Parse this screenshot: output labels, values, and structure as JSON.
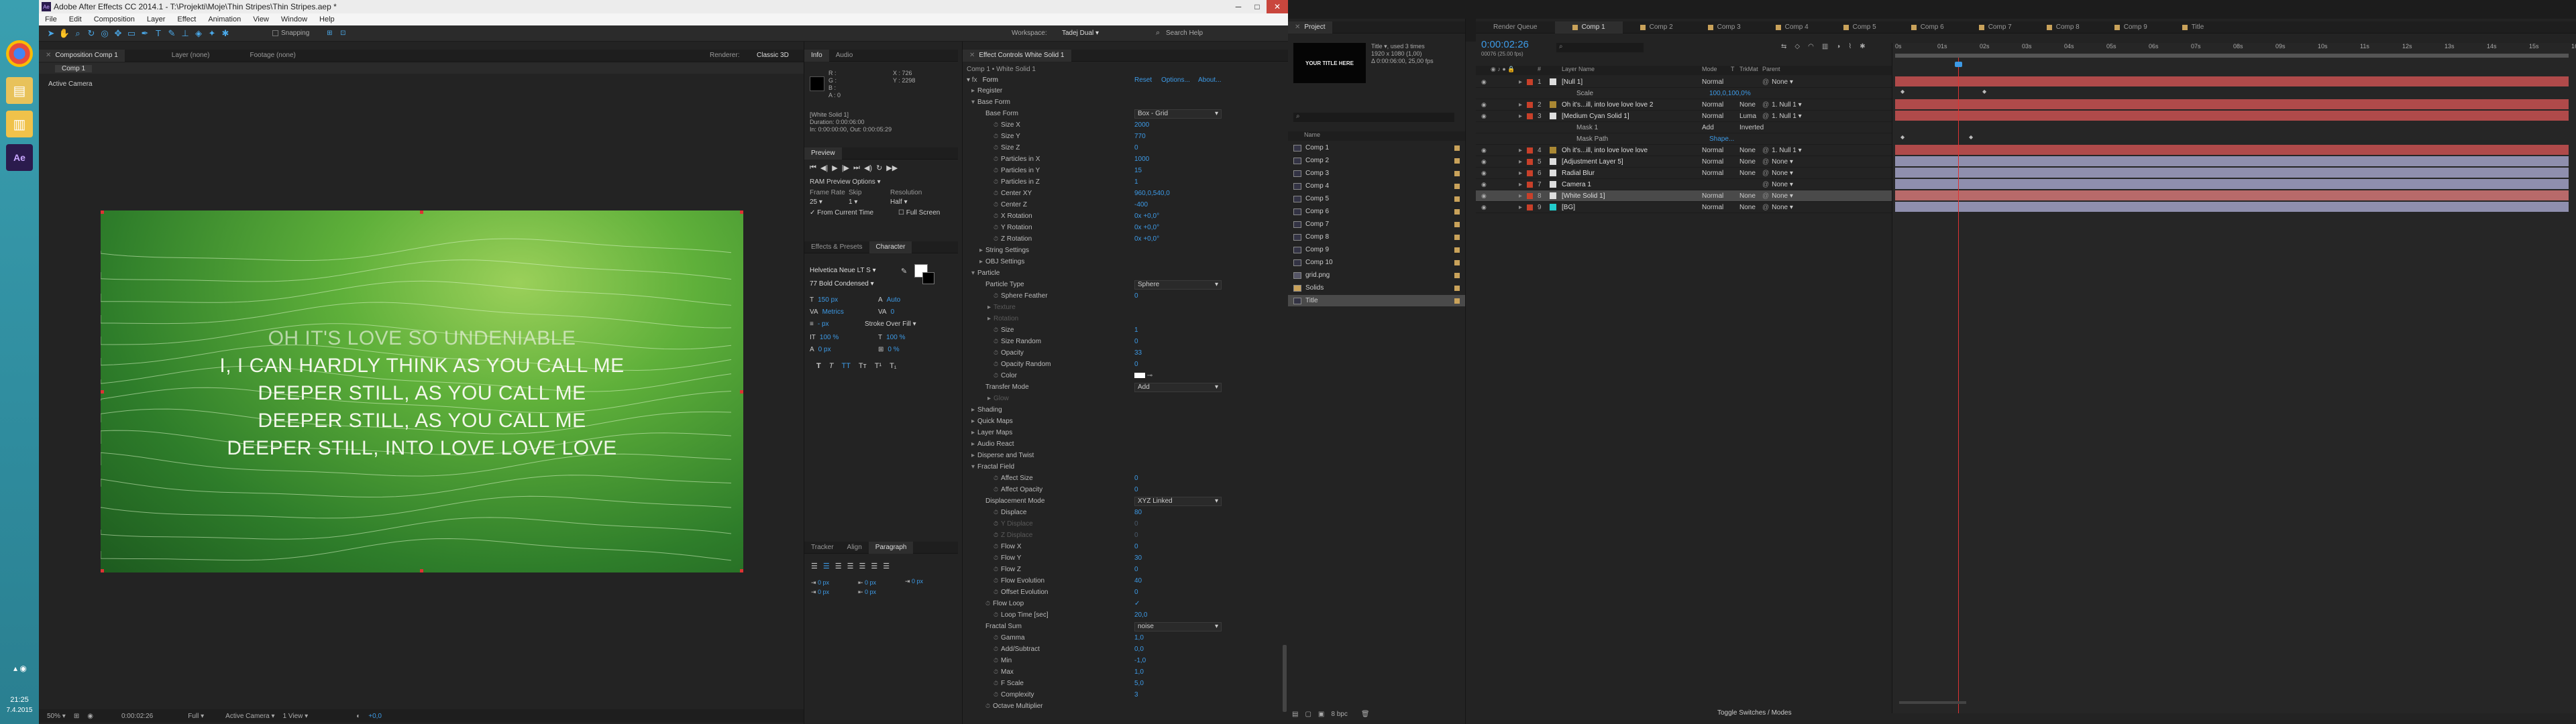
{
  "taskbar": {
    "time": "21:25",
    "date": "7.4.2015"
  },
  "app": {
    "title": "Adobe After Effects CC 2014.1 - T:\\Projekti\\Moje\\Thin Stripes\\Thin Stripes.aep *",
    "menu": [
      "File",
      "Edit",
      "Composition",
      "Layer",
      "Effect",
      "Animation",
      "View",
      "Window",
      "Help"
    ],
    "toolbar": {
      "snapping": "Snapping",
      "workspace_label": "Workspace:",
      "workspace": "Tadej Dual",
      "search": "Search Help"
    }
  },
  "composition_panel": {
    "tabs": [
      "Composition Comp 1",
      "Layer (none)",
      "Footage (none)"
    ],
    "renderer_label": "Renderer:",
    "renderer": "Classic 3D",
    "subtab": "Comp 1",
    "view": "Active Camera",
    "lyrics": [
      "OH IT'S LOVE SO UNDENIABLE",
      "I, I CAN HARDLY THINK AS YOU CALL ME",
      "DEEPER STILL, AS YOU CALL ME",
      "DEEPER STILL, AS YOU CALL ME",
      "DEEPER STILL, INTO LOVE LOVE LOVE"
    ],
    "footer": {
      "zoom": "50%",
      "timecode": "0:00:02:26",
      "quality": "Full",
      "camera": "Active Camera",
      "views": "1 View",
      "offset": "+0,0"
    }
  },
  "info_panel": {
    "tabs": [
      "Info",
      "Audio"
    ],
    "rgb": [
      "R :",
      "G :",
      "B :",
      "A : 0"
    ],
    "xy": [
      "X : 726",
      "Y : 2298"
    ],
    "layer_info": [
      "[White Solid 1]",
      "Duration: 0:00:06:00",
      "In: 0:00:00:00, Out: 0:00:05:29"
    ]
  },
  "preview_panel": {
    "title": "Preview",
    "ram_options": "RAM Preview Options",
    "frame_rate_label": "Frame Rate",
    "skip_label": "Skip",
    "resolution_label": "Resolution",
    "frame_rate": "25",
    "skip": "1",
    "resolution": "Half",
    "from_current": "From Current Time",
    "full_screen": "Full Screen"
  },
  "character_panel": {
    "tabs": [
      "Effects & Presets",
      "Character"
    ],
    "font": "Helvetica Neue LT S",
    "style": "77 Bold Condensed",
    "size": "150 px",
    "leading": "Auto",
    "tracking": "0",
    "kerning": "Metrics",
    "stroke": "- px",
    "stroke_type": "Stroke Over Fill",
    "v_scale": "100 %",
    "h_scale": "100 %",
    "baseline": "0 px",
    "tsume": "0 %"
  },
  "paragraph_panel": {
    "tabs": [
      "Tracker",
      "Align",
      "Paragraph"
    ],
    "indents": [
      "0 px",
      "0 px",
      "0 px",
      "0 px",
      "0 px"
    ]
  },
  "effect_controls": {
    "tabs": [
      "Effect Controls White Solid 1"
    ],
    "header": "Comp 1 • White Solid 1",
    "effect": "Form",
    "actions": [
      "Reset",
      "Options...",
      "About..."
    ],
    "rows": [
      {
        "name": "Register",
        "indent": 1,
        "tw": "c"
      },
      {
        "name": "Base Form",
        "indent": 1,
        "tw": "o"
      },
      {
        "name": "Base Form",
        "indent": 2,
        "dd": "Box - Grid"
      },
      {
        "name": "Size X",
        "indent": 3,
        "v": "2000"
      },
      {
        "name": "Size Y",
        "indent": 3,
        "v": "770"
      },
      {
        "name": "Size Z",
        "indent": 3,
        "v": "0"
      },
      {
        "name": "Particles in X",
        "indent": 3,
        "v": "1000"
      },
      {
        "name": "Particles in Y",
        "indent": 3,
        "v": "15"
      },
      {
        "name": "Particles in Z",
        "indent": 3,
        "v": "1"
      },
      {
        "name": "Center XY",
        "indent": 3,
        "v": "960,0,540,0"
      },
      {
        "name": "Center Z",
        "indent": 3,
        "v": "-400"
      },
      {
        "name": "X Rotation",
        "indent": 3,
        "v": "0x +0,0°"
      },
      {
        "name": "Y Rotation",
        "indent": 3,
        "v": "0x +0,0°"
      },
      {
        "name": "Z Rotation",
        "indent": 3,
        "v": "0x +0,0°"
      },
      {
        "name": "String Settings",
        "indent": 2,
        "tw": "c"
      },
      {
        "name": "OBJ Settings",
        "indent": 2,
        "tw": "c"
      },
      {
        "name": "Particle",
        "indent": 1,
        "tw": "o"
      },
      {
        "name": "Particle Type",
        "indent": 2,
        "dd": "Sphere"
      },
      {
        "name": "Sphere Feather",
        "indent": 3,
        "v": "0"
      },
      {
        "name": "Texture",
        "indent": 3,
        "tw": "c",
        "dim": true
      },
      {
        "name": "Rotation",
        "indent": 3,
        "tw": "c",
        "dim": true
      },
      {
        "name": "Size",
        "indent": 3,
        "v": "1"
      },
      {
        "name": "Size Random",
        "indent": 3,
        "v": "0"
      },
      {
        "name": "Opacity",
        "indent": 3,
        "v": "33"
      },
      {
        "name": "Opacity Random",
        "indent": 3,
        "v": "0"
      },
      {
        "name": "Color",
        "indent": 3,
        "v": "color"
      },
      {
        "name": "Transfer Mode",
        "indent": 2,
        "dd": "Add"
      },
      {
        "name": "Glow",
        "indent": 3,
        "tw": "c",
        "dim": true
      },
      {
        "name": "Shading",
        "indent": 1,
        "tw": "c"
      },
      {
        "name": "Quick Maps",
        "indent": 1,
        "tw": "c"
      },
      {
        "name": "Layer Maps",
        "indent": 1,
        "tw": "c"
      },
      {
        "name": "Audio React",
        "indent": 1,
        "tw": "c"
      },
      {
        "name": "Disperse and Twist",
        "indent": 1,
        "tw": "c"
      },
      {
        "name": "Fractal Field",
        "indent": 1,
        "tw": "o"
      },
      {
        "name": "Affect Size",
        "indent": 3,
        "v": "0"
      },
      {
        "name": "Affect Opacity",
        "indent": 3,
        "v": "0"
      },
      {
        "name": "Displacement Mode",
        "indent": 2,
        "dd": "XYZ Linked"
      },
      {
        "name": "Displace",
        "indent": 3,
        "v": "80"
      },
      {
        "name": "Y Displace",
        "indent": 3,
        "v": "0",
        "dim": true
      },
      {
        "name": "Z Displace",
        "indent": 3,
        "v": "0",
        "dim": true
      },
      {
        "name": "Flow X",
        "indent": 3,
        "v": "0"
      },
      {
        "name": "Flow Y",
        "indent": 3,
        "v": "30"
      },
      {
        "name": "Flow Z",
        "indent": 3,
        "v": "0"
      },
      {
        "name": "Flow Evolution",
        "indent": 3,
        "v": "40"
      },
      {
        "name": "Offset Evolution",
        "indent": 3,
        "v": "0"
      },
      {
        "name": "Flow Loop",
        "indent": 2,
        "v": "✓"
      },
      {
        "name": "Loop Time [sec]",
        "indent": 3,
        "v": "20,0"
      },
      {
        "name": "Fractal Sum",
        "indent": 2,
        "dd": "noise"
      },
      {
        "name": "Gamma",
        "indent": 3,
        "v": "1,0"
      },
      {
        "name": "Add/Subtract",
        "indent": 3,
        "v": "0,0"
      },
      {
        "name": "Min",
        "indent": 3,
        "v": "-1,0"
      },
      {
        "name": "Max",
        "indent": 3,
        "v": "1,0"
      },
      {
        "name": "F Scale",
        "indent": 3,
        "v": "5,0"
      },
      {
        "name": "Complexity",
        "indent": 3,
        "v": "3"
      },
      {
        "name": "Octave Multiplier",
        "indent": 2,
        "v": ""
      }
    ]
  },
  "project_panel": {
    "tab": "Project",
    "thumb_title": "YOUR TITLE HERE",
    "info": [
      "Title ▾, used 3 times",
      "1920 x 1080 (1,00)",
      "Δ 0:00:06:00, 25,00 fps"
    ],
    "col_name": "Name",
    "items": [
      "Comp 1",
      "Comp 2",
      "Comp 3",
      "Comp 4",
      "Comp 5",
      "Comp 6",
      "Comp 7",
      "Comp 8",
      "Comp 9",
      "Comp 10",
      "grid.png",
      "Solids",
      "Title"
    ],
    "bpc": "8 bpc"
  },
  "timeline": {
    "tabs": [
      "Render Queue",
      "Comp 1",
      "Comp 2",
      "Comp 3",
      "Comp 4",
      "Comp 5",
      "Comp 6",
      "Comp 7",
      "Comp 8",
      "Comp 9",
      "Title"
    ],
    "timecode": "0:00:02:26",
    "frames": "00076 (25.00 fps)",
    "headers": [
      "#",
      "Layer Name",
      "Mode",
      "T",
      "TrkMat",
      "Parent"
    ],
    "layers": [
      {
        "num": "1",
        "name": "[Null 1]",
        "mode": "Normal",
        "trk": "",
        "parent": "None",
        "color": "#c8402a"
      },
      {
        "num": "",
        "name": "Scale",
        "mode": "",
        "trk": "",
        "parent": "",
        "color": "",
        "sub": true,
        "val": "100,0,100,0%"
      },
      {
        "num": "2",
        "name": "Oh it's...ill, into love love love 2",
        "mode": "Normal",
        "trk": "None",
        "parent": "1. Null 1",
        "color": "#c8402a"
      },
      {
        "num": "3",
        "name": "[Medium Cyan Solid 1]",
        "mode": "Normal",
        "trk": "Luma",
        "parent": "1. Null 1",
        "color": "#c8402a"
      },
      {
        "num": "",
        "name": "Mask 1",
        "mode": "Add",
        "trk": "Inverted",
        "parent": "",
        "color": "",
        "sub": true
      },
      {
        "num": "",
        "name": "Mask Path",
        "mode": "",
        "trk": "",
        "parent": "",
        "color": "",
        "sub": true,
        "val": "Shape..."
      },
      {
        "num": "4",
        "name": "Oh it's...ill, into love love love",
        "mode": "Normal",
        "trk": "None",
        "parent": "1. Null 1",
        "color": "#c8402a"
      },
      {
        "num": "5",
        "name": "[Adjustment Layer 5]",
        "mode": "Normal",
        "trk": "None",
        "parent": "None",
        "color": "#c8402a"
      },
      {
        "num": "6",
        "name": "Radial Blur",
        "mode": "Normal",
        "trk": "None",
        "parent": "None",
        "color": "#c8402a"
      },
      {
        "num": "7",
        "name": "Camera 1",
        "mode": "",
        "trk": "",
        "parent": "None",
        "color": "#c8402a"
      },
      {
        "num": "8",
        "name": "[White Solid 1]",
        "mode": "Normal",
        "trk": "None",
        "parent": "None",
        "color": "#c8402a",
        "selected": true
      },
      {
        "num": "9",
        "name": "[BG]",
        "mode": "Normal",
        "trk": "None",
        "parent": "None",
        "color": "#c8402a"
      }
    ],
    "ruler": [
      "0s",
      "01s",
      "02s",
      "03s",
      "04s",
      "05s",
      "06s",
      "07s",
      "08s",
      "09s",
      "10s",
      "11s",
      "12s",
      "13s",
      "14s",
      "15s",
      "16s"
    ],
    "footer": "Toggle Switches / Modes"
  }
}
